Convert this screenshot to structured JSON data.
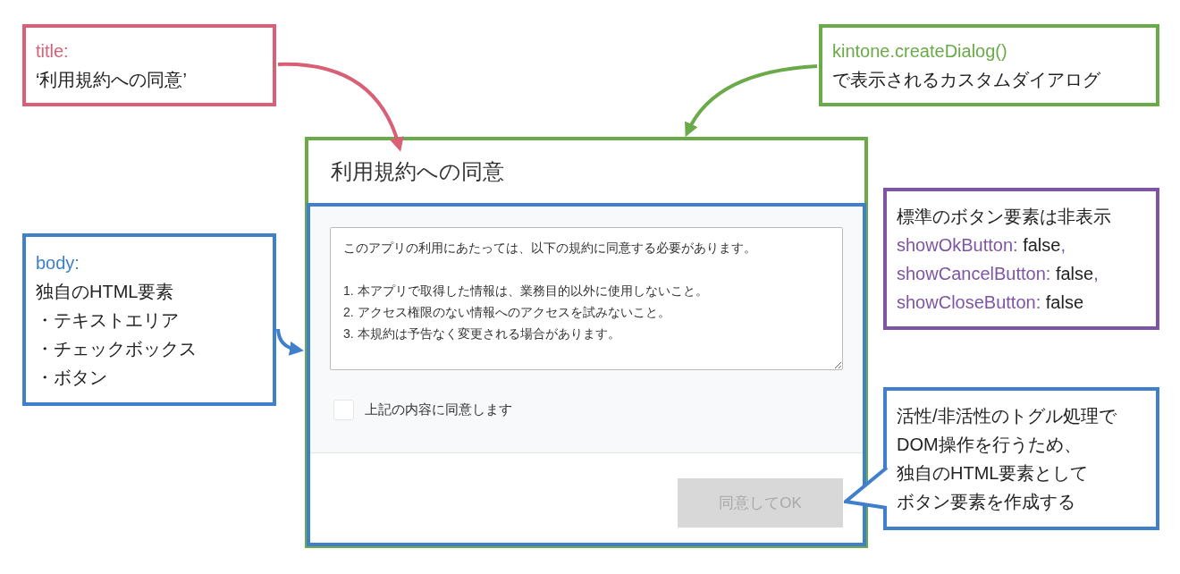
{
  "callouts": [
    {
      "kind": "plain",
      "color": "#d95f76",
      "heading": "title:",
      "lines": [
        "‘利用規約への同意’"
      ]
    },
    {
      "kind": "plain",
      "color": "#6aaa48",
      "heading": "kintone.createDialog()",
      "lines": [
        "で表示されるカスタムダイアログ"
      ]
    },
    {
      "kind": "options",
      "color": "#7d55a3",
      "lines": [
        "標準のボタン要素は非表示"
      ],
      "options": [
        {
          "key": "showOkButton:",
          "value": "false",
          "sep": ","
        },
        {
          "key": "showCancelButton:",
          "value": "false",
          "sep": ","
        },
        {
          "key": "showCloseButton:",
          "value": "false"
        }
      ]
    },
    {
      "kind": "plain",
      "color": "#3f7fcc",
      "heading": "body:",
      "lines": [
        "独自のHTML要素",
        "・テキストエリア",
        "・チェックボックス",
        "・ボタン"
      ]
    },
    {
      "kind": "pointer",
      "color": "#3f7fcc",
      "lines": [
        "活性/非活性のトグル処理で",
        "DOM操作を行うため、",
        "独自のHTML要素として",
        "ボタン要素を作成する"
      ]
    }
  ],
  "dialog": {
    "title": "利用規約への同意",
    "textarea": "このアプリの利用にあたっては、以下の規約に同意する必要があります。\n\n1. 本アプリで取得した情報は、業務目的以外に使用しないこと。\n2. アクセス権限のない情報へのアクセスを試みないこと。\n3. 本規約は予告なく変更される場合があります。",
    "checkbox": {
      "label": "上記の内容に同意します",
      "checked": false
    },
    "ok_button": {
      "label": "同意してOK",
      "disabled": true
    }
  }
}
